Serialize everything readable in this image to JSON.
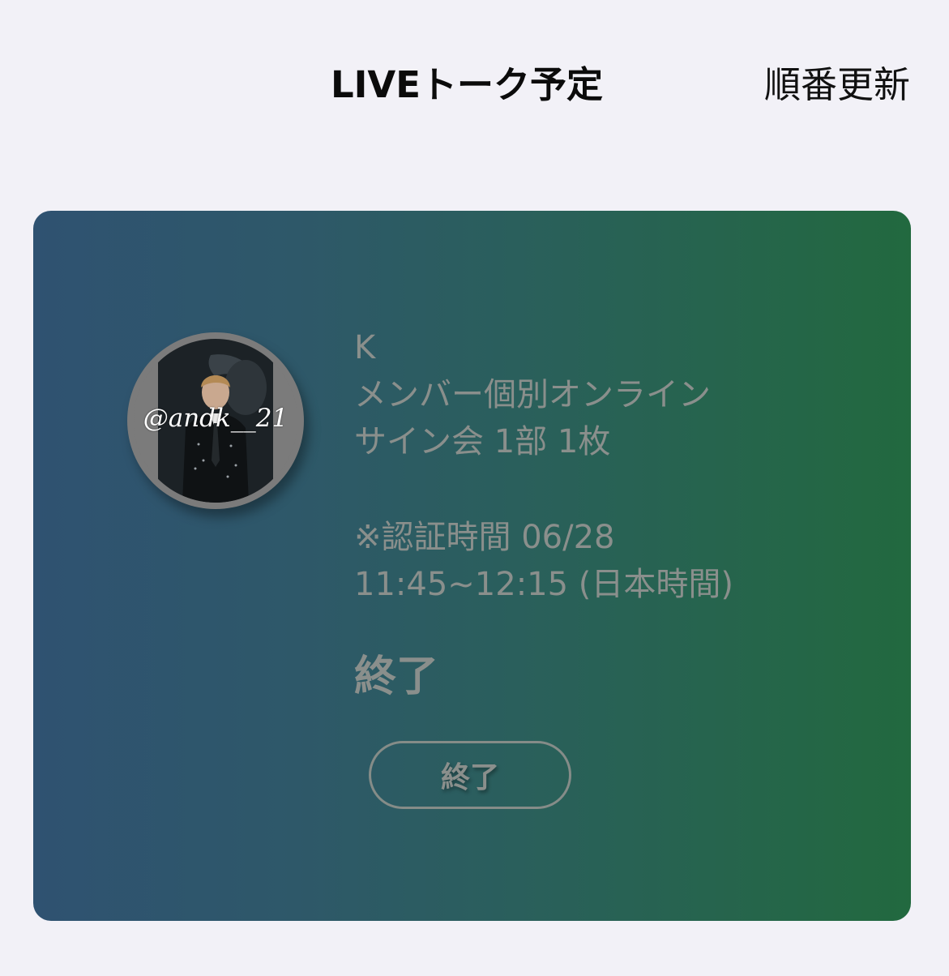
{
  "header": {
    "title": "LIVEトーク予定",
    "reorder_label": "順番更新"
  },
  "card": {
    "avatar_watermark": "@andk__21",
    "member_initial": "K",
    "event_line1": "メンバー個別オンライン",
    "event_line2": "サイン会 1部 1枚",
    "auth_line1": "※認証時間 06/28",
    "auth_line2": "11:45~12:15 (日本時間)",
    "status": "終了",
    "button_label": "終了"
  }
}
